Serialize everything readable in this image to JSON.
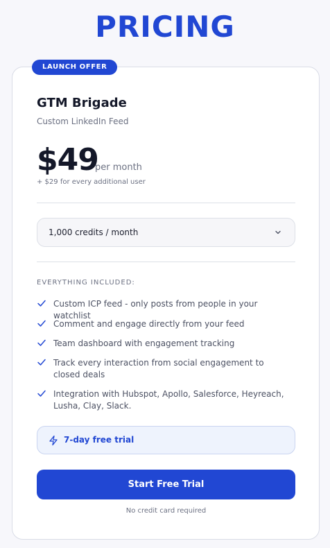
{
  "header": {
    "title": "PRICING"
  },
  "card": {
    "badge": "LAUNCH OFFER",
    "plan_name": "GTM Brigade",
    "plan_subtitle": "Custom LinkedIn Feed",
    "price": "$49",
    "period": "per month",
    "additional_user": "+ $29 for every additional user",
    "credits_select": {
      "value": "1,000 credits / month"
    },
    "included_heading": "EVERYTHING INCLUDED:",
    "features": [
      "Custom ICP feed - only posts from people in your watchlist",
      "Comment and engage directly from your feed",
      "Team dashboard with engagement tracking",
      "Track every interaction from social engagement to closed deals",
      "Integration with Hubspot, Apollo, Salesforce, Heyreach, Lusha, Clay, Slack."
    ],
    "trial_label": "7-day free trial",
    "cta_label": "Start Free Trial",
    "footnote": "No credit card required"
  },
  "colors": {
    "accent": "#2147d3",
    "text": "#141829",
    "muted": "#6b7082"
  },
  "icons": {
    "select": "chevron-down-icon",
    "feature": "check-icon",
    "trial": "lightning-icon"
  }
}
